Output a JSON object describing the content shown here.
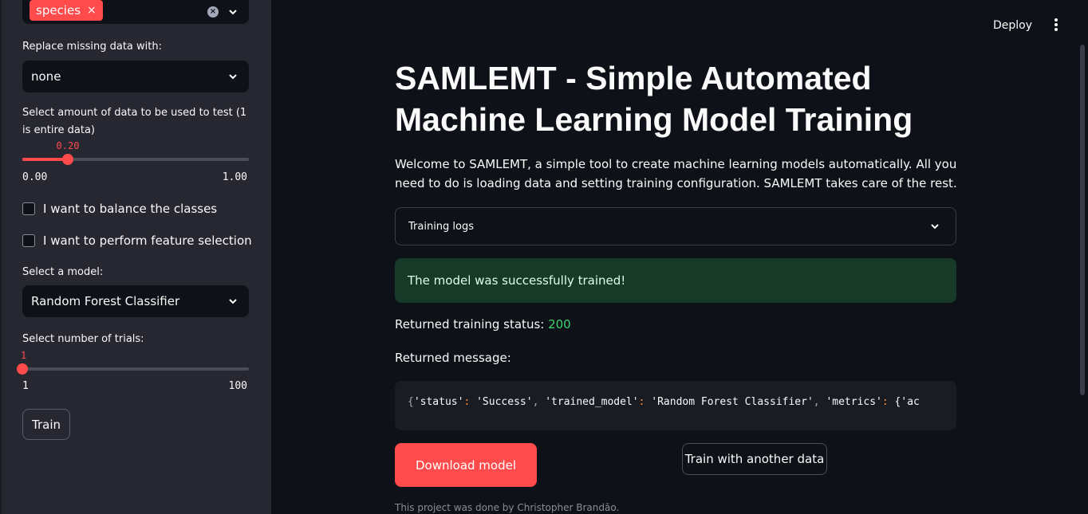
{
  "sidebar": {
    "multiselect": {
      "tag_label": "species",
      "tag_remove": "×",
      "clear_icon": "×"
    },
    "missing_data": {
      "label": "Replace missing data with:",
      "value": "none"
    },
    "test_size": {
      "label": "Select amount of data to be used to test (1 is entire data)",
      "value": "0.20",
      "min": "0.00",
      "max": "1.00",
      "fraction": 0.2
    },
    "balance_classes": {
      "label": "I want to balance the classes"
    },
    "feature_selection": {
      "label": "I want to perform feature selection"
    },
    "model": {
      "label": "Select a model:",
      "value": "Random Forest Classifier"
    },
    "trials": {
      "label": "Select number of trials:",
      "value": "1",
      "min": "1",
      "max": "100",
      "fraction": 0.0
    },
    "train_button": "Train"
  },
  "header": {
    "deploy": "Deploy"
  },
  "main": {
    "title": "SAMLEMT - Simple Automated Machine Learning Model Training",
    "intro": "Welcome to SAMLEMT, a simple tool to create machine learning models automatically. All you need to do is loading data and setting training configuration. SAMLEMT takes care of the rest.",
    "expander": "Training logs",
    "success": "The model was successfully trained!",
    "status_label": "Returned training status: ",
    "status_value": "200",
    "message_label": "Returned message:",
    "code": {
      "brace": "{",
      "k1": "'status'",
      "colon": ":",
      "v1": "'Success'",
      "comma": ",",
      "k2": "'trained_model'",
      "v2": "'Random Forest Classifier'",
      "k3": "'metrics'",
      "v3": "{'ac"
    },
    "download_button": "Download model",
    "another_button": "Train with another data",
    "footer": "This project was done by Christopher Brandão."
  }
}
